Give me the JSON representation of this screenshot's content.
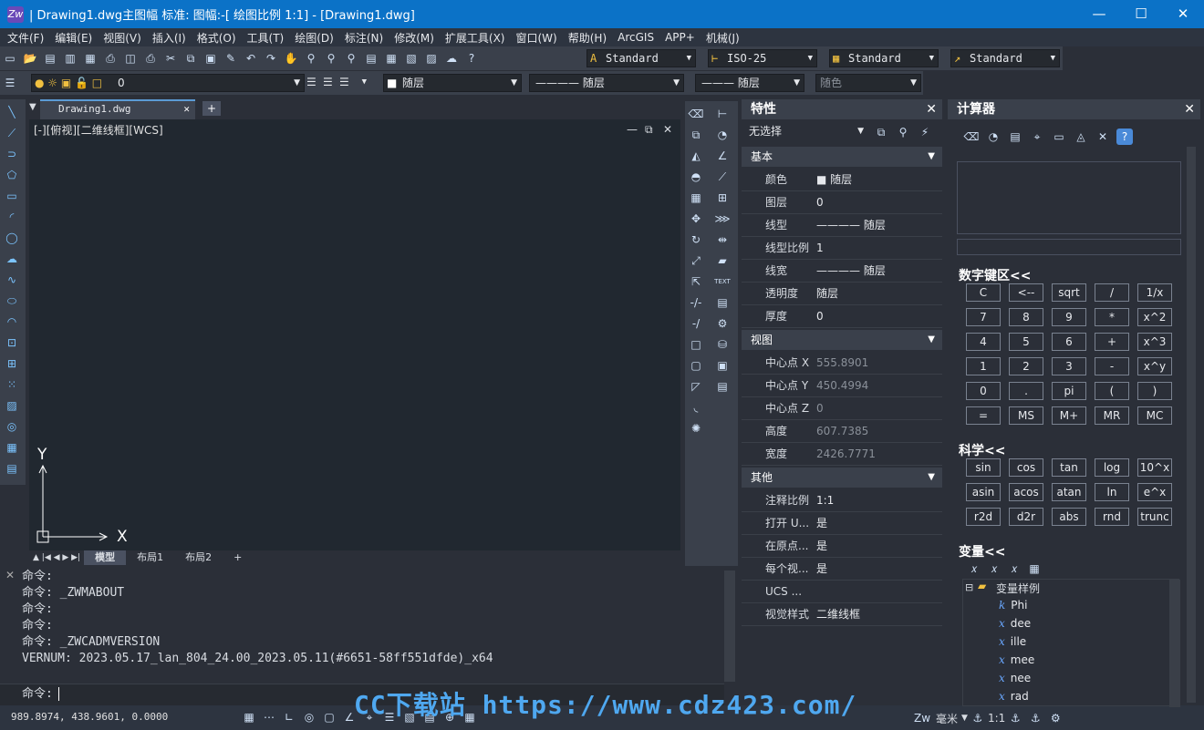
{
  "app": {
    "logo_text": "Zw",
    "title": "| Drawing1.dwg主图幅  标准: 图幅:-[ 绘图比例 1:1] - [Drawing1.dwg]",
    "minimize": "—",
    "maximize": "☐",
    "close": "✕"
  },
  "menu": [
    "文件(F)",
    "编辑(E)",
    "视图(V)",
    "插入(I)",
    "格式(O)",
    "工具(T)",
    "绘图(D)",
    "标注(N)",
    "修改(M)",
    "扩展工具(X)",
    "窗口(W)",
    "帮助(H)",
    "ArcGIS",
    "APP+",
    "机械(J)"
  ],
  "toolbar1": {
    "text_style": "Standard",
    "dim_style": "ISO-25",
    "table_style": "Standard",
    "mleader_style": "Standard"
  },
  "toolbar2": {
    "layer": "0",
    "color": "随层",
    "linetype": "———— 随层",
    "lineweight": "——— 随层",
    "plotstyle": "随色"
  },
  "doc_tab": {
    "label": "Drawing1.dwg",
    "close": "✕",
    "arrow": "▼",
    "new": "+"
  },
  "viewport": {
    "label": "[-][俯视][二维线框][WCS]",
    "min": "—",
    "restore": "⧉",
    "close": "✕",
    "axis_y": "Y",
    "axis_x": "X"
  },
  "layout_tabs": [
    "模型",
    "布局1",
    "布局2",
    "+"
  ],
  "command": {
    "lines": [
      "命令:",
      "命令: _ZWMABOUT",
      "命令:",
      "命令:",
      "命令: _ZWCADMVERSION",
      "VERNUM: 2023.05.17_lan_804_24.00_2023.05.11(#6651-58ff551dfde)_x64"
    ],
    "prompt": "命令:",
    "close": "✕"
  },
  "status": {
    "coords": "989.8974, 438.9601, 0.0000",
    "units": "毫米",
    "scale": "1:1"
  },
  "properties": {
    "title": "特性",
    "close": "✕",
    "selection": "无选择",
    "sections": [
      {
        "name": "基本",
        "rows": [
          {
            "k": "颜色",
            "v": "■ 随层"
          },
          {
            "k": "图层",
            "v": "0"
          },
          {
            "k": "线型",
            "v": "———— 随层"
          },
          {
            "k": "线型比例",
            "v": "1"
          },
          {
            "k": "线宽",
            "v": "———— 随层"
          },
          {
            "k": "透明度",
            "v": "随层"
          },
          {
            "k": "厚度",
            "v": "0"
          }
        ]
      },
      {
        "name": "视图",
        "rows": [
          {
            "k": "中心点 X",
            "v": "555.8901"
          },
          {
            "k": "中心点 Y",
            "v": "450.4994"
          },
          {
            "k": "中心点 Z",
            "v": "0"
          },
          {
            "k": "高度",
            "v": "607.7385"
          },
          {
            "k": "宽度",
            "v": "2426.7771"
          }
        ]
      },
      {
        "name": "其他",
        "rows": [
          {
            "k": "注释比例",
            "v": "1:1"
          },
          {
            "k": "打开 U...",
            "v": "是"
          },
          {
            "k": "在原点...",
            "v": "是"
          },
          {
            "k": "每个视...",
            "v": "是"
          },
          {
            "k": "UCS ...",
            "v": ""
          },
          {
            "k": "视觉样式",
            "v": "二维线框"
          }
        ]
      }
    ]
  },
  "calculator": {
    "title": "计算器",
    "close": "✕",
    "numpad_title": "数字键区<<",
    "numpad": [
      [
        "C",
        "<--",
        "sqrt",
        "/",
        "1/x"
      ],
      [
        "7",
        "8",
        "9",
        "*",
        "x^2"
      ],
      [
        "4",
        "5",
        "6",
        "+",
        "x^3"
      ],
      [
        "1",
        "2",
        "3",
        "-",
        "x^y"
      ],
      [
        "0",
        ".",
        "pi",
        "(",
        ")"
      ],
      [
        "=",
        "MS",
        "M+",
        "MR",
        "MC"
      ]
    ],
    "sci_title": "科学<<",
    "sci": [
      [
        "sin",
        "cos",
        "tan",
        "log",
        "10^x"
      ],
      [
        "asin",
        "acos",
        "atan",
        "ln",
        "e^x"
      ],
      [
        "r2d",
        "d2r",
        "abs",
        "rnd",
        "trunc"
      ]
    ],
    "var_title": "变量<<",
    "tree_root": "变量样例",
    "vars": [
      {
        "icon": "k",
        "name": "Phi"
      },
      {
        "icon": "x",
        "name": "dee"
      },
      {
        "icon": "x",
        "name": "ille"
      },
      {
        "icon": "x",
        "name": "mee"
      },
      {
        "icon": "x",
        "name": "nee"
      },
      {
        "icon": "x",
        "name": "rad"
      }
    ]
  },
  "watermark": "CC下载站 https://www.cdz423.com/"
}
